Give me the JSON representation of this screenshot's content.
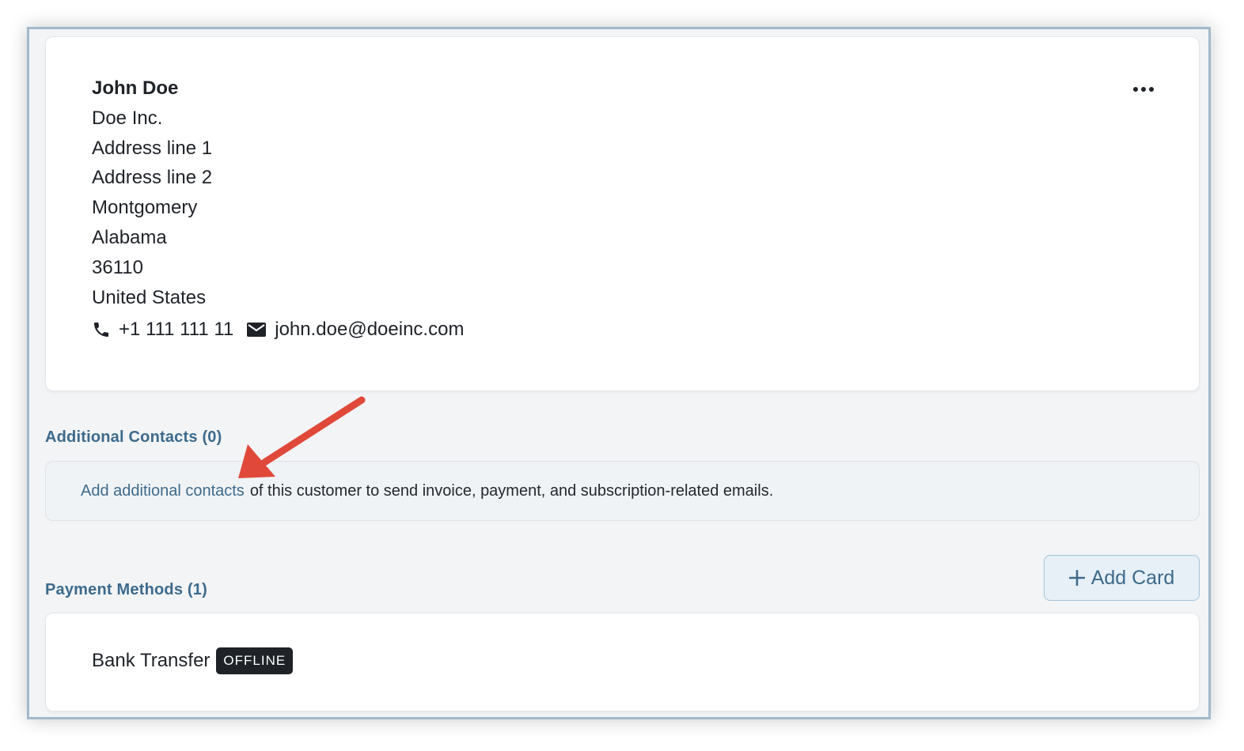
{
  "customer": {
    "name": "John Doe",
    "company": "Doe Inc.",
    "address_line_1": "Address line 1",
    "address_line_2": "Address line 2",
    "city": "Montgomery",
    "state": "Alabama",
    "zip": "36110",
    "country": "United States",
    "phone": "+1 111 111 11",
    "email": "john.doe@doeinc.com"
  },
  "icons": {
    "more": "more-horizontal-icon",
    "phone": "phone-icon",
    "email": "mail-icon",
    "plus": "plus-icon"
  },
  "additional_contacts": {
    "title": "Additional Contacts (0)",
    "link_text": "Add additional contacts",
    "rest_text": "of this customer to send invoice, payment, and subscription-related emails."
  },
  "payment_methods": {
    "title": "Payment Methods (1)",
    "add_card_label": "Add Card",
    "items": [
      {
        "name": "Bank Transfer",
        "badge": "OFFLINE"
      }
    ]
  },
  "colors": {
    "accent": "#3d6a8c",
    "annotation_arrow": "#e0493a",
    "badge_bg": "#1f2328",
    "frame_border": "#a3b9c9"
  }
}
